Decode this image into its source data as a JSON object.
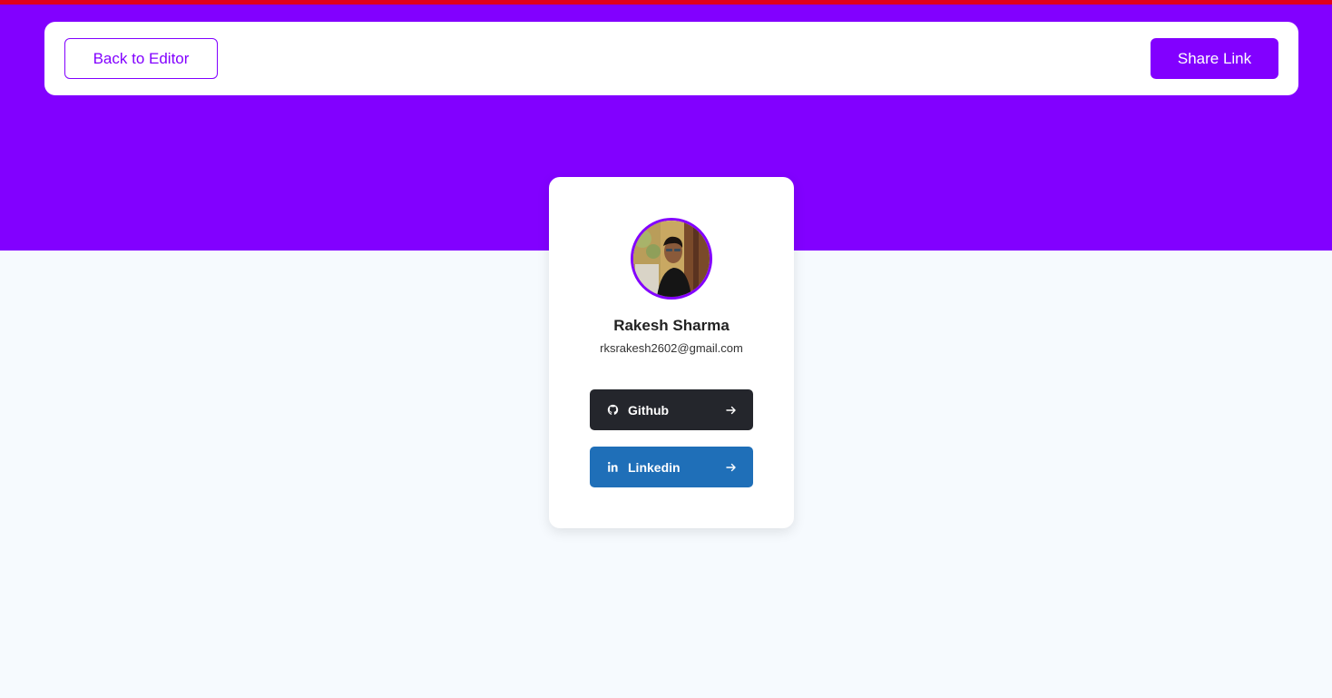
{
  "header": {
    "back_label": "Back to Editor",
    "share_label": "Share Link"
  },
  "profile": {
    "name": "Rakesh Sharma",
    "email": "rksrakesh2602@gmail.com"
  },
  "links": [
    {
      "label": "Github",
      "icon": "github-icon",
      "color": "#24262c"
    },
    {
      "label": "Linkedin",
      "icon": "linkedin-icon",
      "color": "#1f6fb8"
    }
  ],
  "colors": {
    "brand": "#8200ff",
    "top_accent": "#e0001b",
    "page_background": "#f6fafe"
  }
}
